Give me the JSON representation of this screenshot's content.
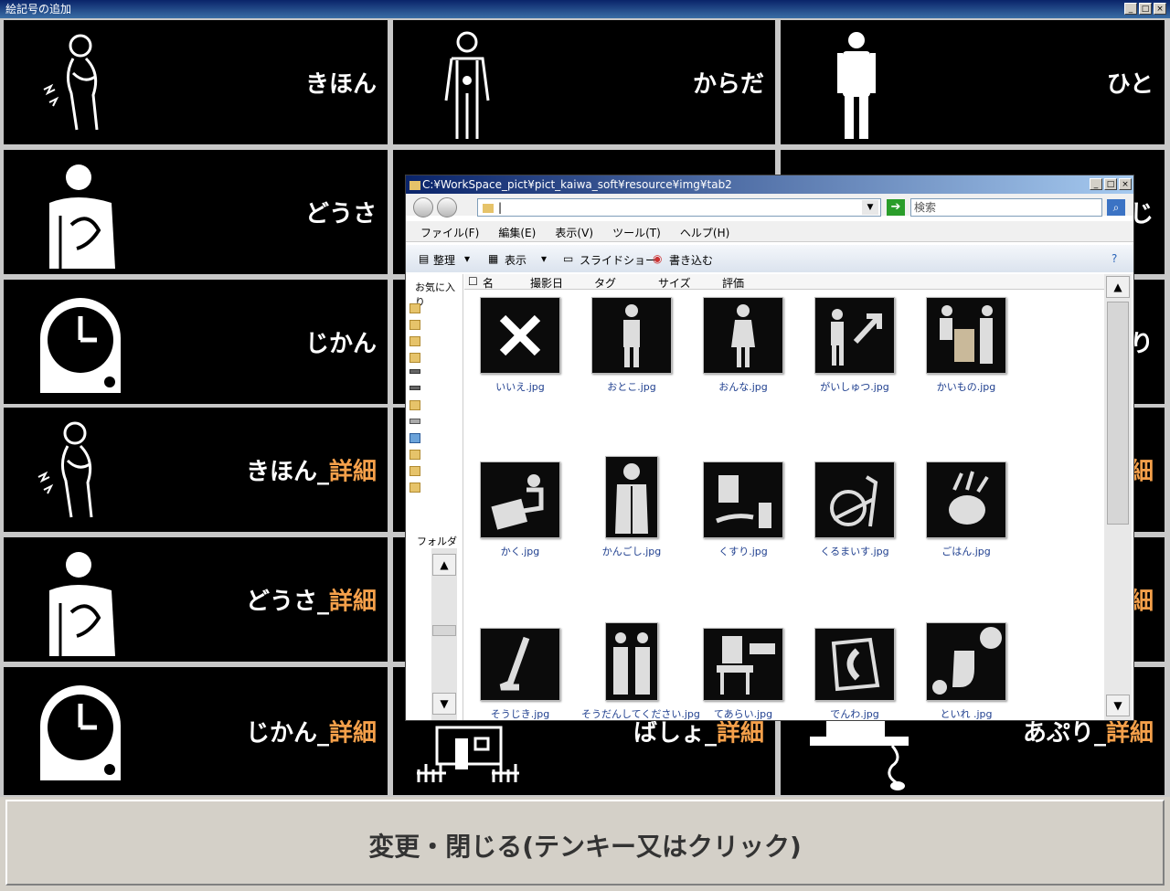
{
  "window": {
    "title": "絵記号の追加",
    "min": "_",
    "max": "□",
    "close": "×"
  },
  "cells": [
    {
      "label": "きほん",
      "detail": ""
    },
    {
      "label": "からだ",
      "detail": ""
    },
    {
      "label": "ひと",
      "detail": ""
    },
    {
      "label": "どうさ",
      "detail": ""
    },
    {
      "label": "じ",
      "detail": ""
    },
    {
      "label": "じかん",
      "detail": ""
    },
    {
      "label": "り",
      "detail": ""
    },
    {
      "label": "きほん",
      "detail": "詳細"
    },
    {
      "label": "",
      "detail": "詳細"
    },
    {
      "label": "どうさ",
      "detail": "詳細"
    },
    {
      "label": "",
      "detail": "詳細"
    },
    {
      "label": "じかん",
      "detail": "詳細"
    },
    {
      "label": "ばしょ",
      "detail": "詳細"
    },
    {
      "label": "あぷり",
      "detail": "詳細"
    }
  ],
  "bottom_button": "変更・閉じる(テンキー又はクリック)",
  "explorer": {
    "title": "C:¥WorkSpace_pict¥pict_kaiwa_soft¥resource¥img¥tab2",
    "address_value": "|",
    "search_placeholder": "検索",
    "menu": [
      "ファイル(F)",
      "編集(E)",
      "表示(V)",
      "ツール(T)",
      "ヘルプ(H)"
    ],
    "commands": [
      "整理",
      "表示",
      "スライドショー",
      "書き込む"
    ],
    "favorites_label": "お気に入り",
    "folders_label": "フォルダ",
    "columns": [
      "名",
      "撮影日",
      "タグ",
      "サイズ",
      "評価"
    ],
    "files": [
      "いいえ.jpg",
      "おとこ.jpg",
      "おんな.jpg",
      "がいしゅつ.jpg",
      "かいもの.jpg",
      "かく.jpg",
      "かんごし.jpg",
      "くすり.jpg",
      "くるまいす.jpg",
      "ごはん.jpg",
      "そうじき.jpg",
      "そうだんしてください.jpg",
      "てあらい.jpg",
      "でんわ.jpg",
      "といれ .jpg"
    ]
  }
}
